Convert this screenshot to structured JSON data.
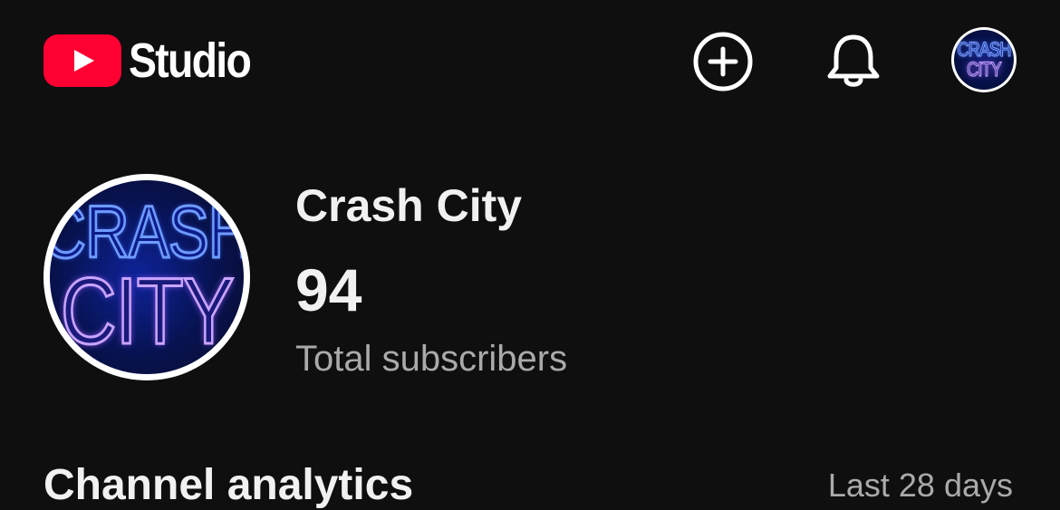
{
  "header": {
    "app_name": "Studio",
    "icons": {
      "logo": "youtube-play-icon",
      "create": "plus-circle-icon",
      "notifications": "bell-icon",
      "account": "channel-avatar"
    },
    "brand_color": "#ff0033"
  },
  "channel": {
    "name": "Crash City",
    "subscriber_count": "94",
    "subscriber_label": "Total subscribers",
    "avatar_text": {
      "line1": "CRASH",
      "line2": "CITY"
    }
  },
  "analytics": {
    "title": "Channel analytics",
    "range": "Last 28 days"
  },
  "colors": {
    "background": "#0f0f0f",
    "text_primary": "#f1f1f1",
    "text_secondary": "#aaaaaa"
  }
}
